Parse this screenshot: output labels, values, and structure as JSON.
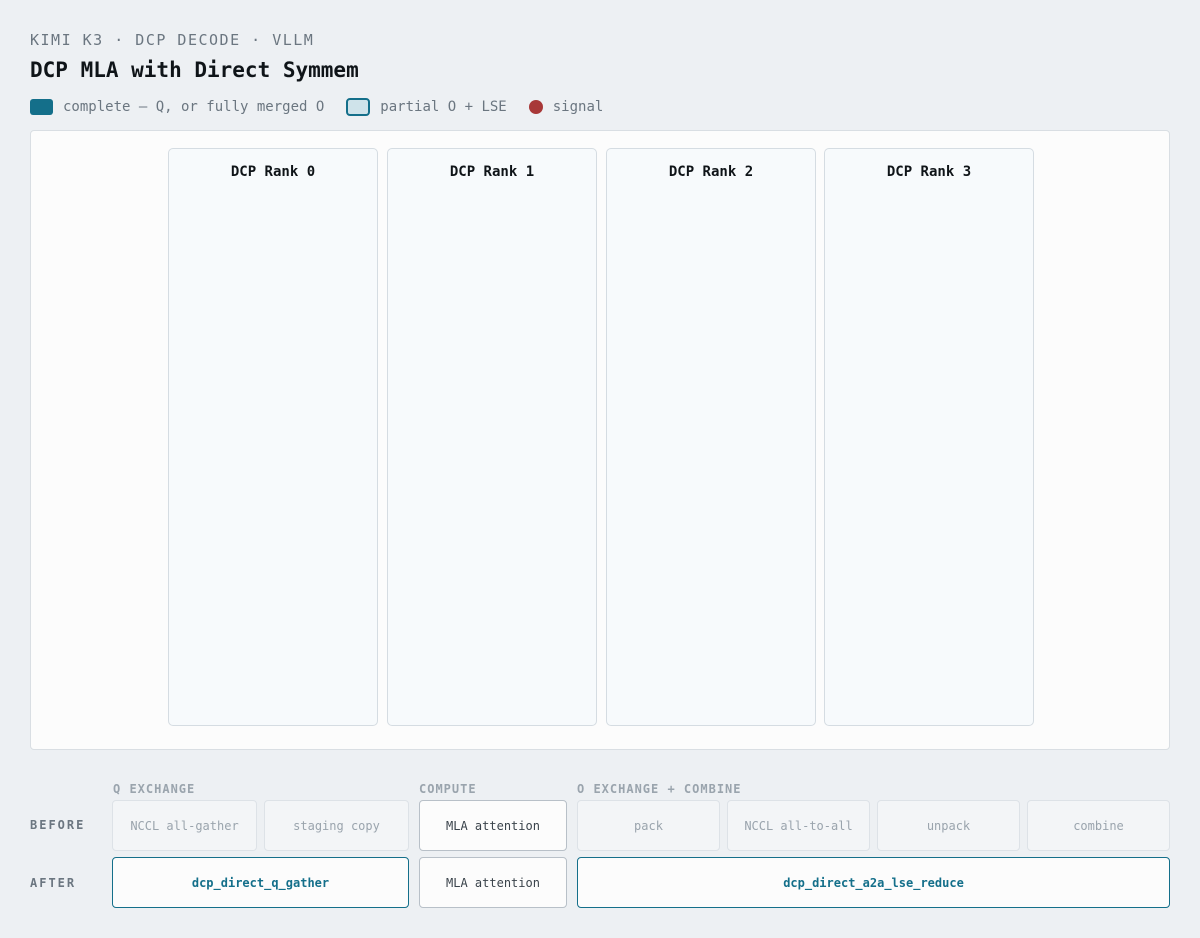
{
  "header": {
    "eyebrow": "KIMI K3 · DCP DECODE · VLLM",
    "title": "DCP MLA with Direct Symmem"
  },
  "legend": {
    "complete": "complete — Q, or fully merged O",
    "partial": "partial O + LSE",
    "signal": "signal"
  },
  "colors": {
    "accent": "#146f8a",
    "partial_fill": "#cfe3ea",
    "signal": "#a83838"
  },
  "ranks": [
    "DCP Rank 0",
    "DCP Rank 1",
    "DCP Rank 2",
    "DCP Rank 3"
  ],
  "timeline": {
    "phases": {
      "q_exchange": "Q EXCHANGE",
      "compute": "COMPUTE",
      "o_exchange": "O EXCHANGE + COMBINE"
    },
    "before": {
      "label": "BEFORE",
      "steps": [
        "NCCL all-gather",
        "staging copy",
        "MLA attention",
        "pack",
        "NCCL all-to-all",
        "unpack",
        "combine"
      ]
    },
    "after": {
      "label": "AFTER",
      "steps": [
        "dcp_direct_q_gather",
        "MLA attention",
        "dcp_direct_a2a_lse_reduce"
      ]
    }
  }
}
